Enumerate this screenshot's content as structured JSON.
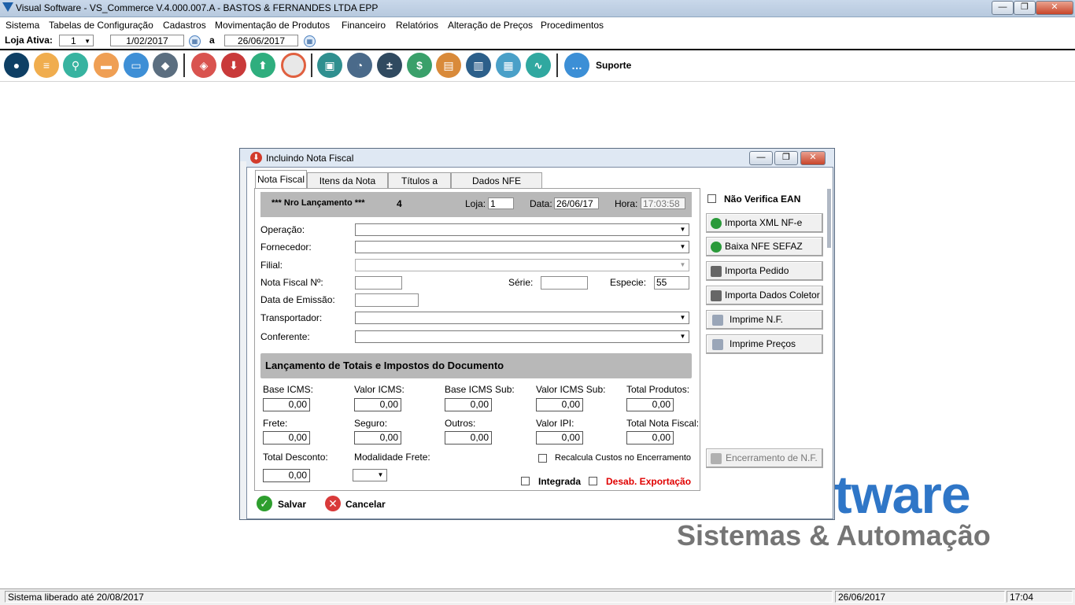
{
  "window": {
    "title": "Visual Software - VS_Commerce V.4.000.007.A - BASTOS & FERNANDES LTDA EPP",
    "buttons": {
      "minimize": "—",
      "maximize": "❐",
      "close": "✕"
    }
  },
  "menu": [
    "Sistema",
    "Tabelas de Configuração",
    "Cadastros",
    "Movimentação de Produtos",
    "Financeiro",
    "Relatórios",
    "Alteração de Preços",
    "Procedimentos"
  ],
  "store": {
    "label": "Loja Ativa:",
    "value": "1",
    "date_from": "1/02/2017",
    "separator": "a",
    "date_to": "26/06/2017"
  },
  "toolbar": {
    "icons": [
      "user-icon",
      "basket-icon",
      "cart-icon",
      "truck-icon",
      "card-icon",
      "layers-icon",
      "tag-icon",
      "download-icon",
      "upload-icon",
      "lifebuoy-icon",
      "money-icon",
      "pie-chart-icon",
      "calculator-icon",
      "cash-icon",
      "briefcase-icon",
      "bar-chart-icon",
      "books-icon",
      "trend-icon",
      "chat-icon"
    ],
    "support_label": "Suporte"
  },
  "watermark": {
    "line1": "tware",
    "line2": "Sistemas & Automação"
  },
  "dialog": {
    "title": "Incluindo Nota Fiscal",
    "tabs": [
      "Nota Fiscal",
      "Itens da Nota Fiscal",
      "Títulos a Pagar",
      "Dados NFE Importada"
    ],
    "header": {
      "label": "*** Nro Lançamento ***",
      "number": "4",
      "loja_label": "Loja:",
      "loja": "1",
      "data_label": "Data:",
      "data": "26/06/17",
      "hora_label": "Hora:",
      "hora": "17:03:58"
    },
    "fields": {
      "operacao_label": "Operação:",
      "fornecedor_label": "Fornecedor:",
      "filial_label": "Filial:",
      "nota_label": "Nota Fiscal Nº:",
      "serie_label": "Série:",
      "especie_label": "Especie:",
      "especie": "55",
      "emissao_label": "Data de Emissão:",
      "transportador_label": "Transportador:",
      "conferente_label": "Conferente:"
    },
    "totals": {
      "section_title": "Lançamento de Totais e Impostos do Documento",
      "base_icms_label": "Base ICMS:",
      "base_icms": "0,00",
      "valor_icms_label": "Valor ICMS:",
      "valor_icms": "0,00",
      "base_icms_sub_label": "Base ICMS Sub:",
      "base_icms_sub": "0,00",
      "valor_icms_sub_label": "Valor ICMS Sub:",
      "valor_icms_sub": "0,00",
      "total_produtos_label": "Total Produtos:",
      "total_produtos": "0,00",
      "frete_label": "Frete:",
      "frete": "0,00",
      "seguro_label": "Seguro:",
      "seguro": "0,00",
      "outros_label": "Outros:",
      "outros": "0,00",
      "valor_ipi_label": "Valor IPI:",
      "valor_ipi": "0,00",
      "total_nota_label": "Total Nota Fiscal:",
      "total_nota": "0,00",
      "total_desconto_label": "Total Desconto:",
      "total_desconto": "0,00",
      "modalidade_frete_label": "Modalidade Frete:",
      "recalcula_label": "Recalcula Custos no Encerramento",
      "integrada_label": "Integrada",
      "desab_label": "Desab. Exportação"
    },
    "side": {
      "nao_verifica_ean": "Não Verifica EAN",
      "importa_xml": "Importa XML NF-e",
      "baixa_nfe": "Baixa NFE SEFAZ",
      "importa_pedido": "Importa Pedido",
      "importa_coletor": "Importa Dados Coletor",
      "imprime_nf": "Imprime N.F.",
      "imprime_precos": "Imprime Preços",
      "encerramento": "Encerramento de N.F."
    },
    "actions": {
      "salvar": "Salvar",
      "cancelar": "Cancelar"
    }
  },
  "statusbar": {
    "message": "Sistema liberado até 20/08/2017",
    "date": "26/06/2017",
    "time": "17:04"
  },
  "colors": {
    "accent": "#2f76c7",
    "danger": "#e00000",
    "ok": "#2e9e2e"
  }
}
